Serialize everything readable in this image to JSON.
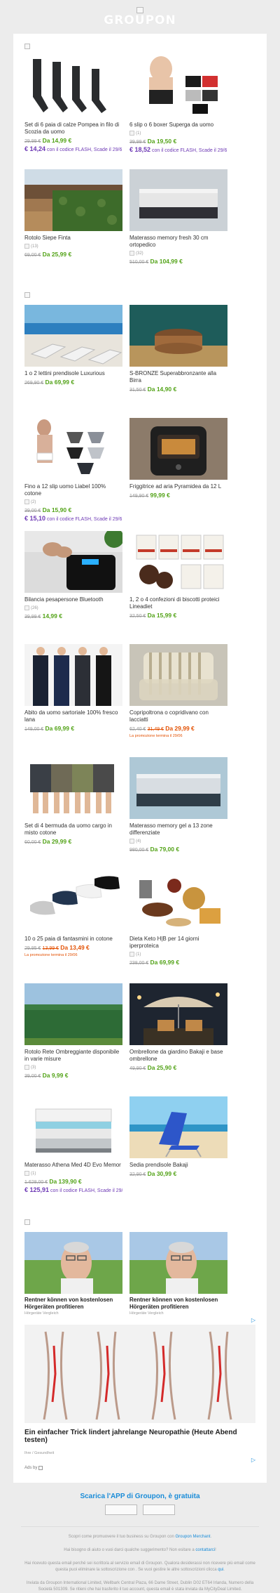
{
  "header": {
    "brand": "GROUPON"
  },
  "sections": [
    {
      "items": [
        {
          "title": "Set di 6 paia di calze Pompea in filo di Scozia da uomo",
          "old": "29,99 €",
          "new": "Da 14,99 €",
          "flash_price": "€ 14,24",
          "flash_text": "con il codice FLASH, Scade il 29/6",
          "image": "socks"
        },
        {
          "title": "6 slip o 6 boxer Superga da uomo",
          "stars": "(1)",
          "old": "39,99 €",
          "new": "Da 19,50 €",
          "flash_price": "€ 18,52",
          "flash_text": "con il codice FLASH, Scade il 29/6",
          "image": "boxers"
        },
        {
          "title": "Rotolo Siepe Finta",
          "stars": "(13)",
          "old": "69,00 €",
          "new": "Da 25,99 €",
          "image": "hedge"
        },
        {
          "title": "Materasso memory fresh 30 cm ortopedico",
          "stars": "(32)",
          "old": "510,00 €",
          "new": "Da 104,99 €",
          "image": "mattress"
        }
      ]
    },
    {
      "items": [
        {
          "title": "1 o 2 lettini prendisole Luxurious",
          "old": "269,90 €",
          "new": "Da 69,99 €",
          "image": "loungers"
        },
        {
          "title": "S-BRONZE Superabbronzante alla Birra",
          "old": "31,50 €",
          "new": "Da 14,90 €",
          "image": "cream"
        },
        {
          "title": "Fino a 12 slip uomo Liabel 100% cotone",
          "stars": "(2)",
          "old": "39,00 €",
          "new": "Da 15,90 €",
          "flash_price": "€ 15,10",
          "flash_text": "con il codice FLASH, Scade il 29/6",
          "image": "briefs"
        },
        {
          "title": "Friggitrice ad aria Pyramidea da 12 L",
          "old": "149,90 €",
          "new": "99,99 €",
          "image": "airfryer"
        },
        {
          "title": "Bilancia pesapersone Bluetooth",
          "stars": "(26)",
          "old": "39,99 €",
          "new": "14,99 €",
          "image": "scale"
        },
        {
          "title": "1, 2 o 4 confezioni di biscotti proteici Lineadiet",
          "old": "32,50 €",
          "new": "Da 15,99 €",
          "image": "biscuits"
        },
        {
          "title": "Abito da uomo sartoriale 100% fresco lana",
          "old": "149,00 €",
          "new": "Da 69,99 €",
          "image": "suits"
        },
        {
          "title": "Copripoltrona o copridivano con lacciatti",
          "old": "62,40 €",
          "old2": "31,49 €",
          "new": "Da 29,99 €",
          "red": true,
          "promo": "La promozione termina il 29/06",
          "image": "sofa"
        },
        {
          "title": "Set di 4 bermuda da uomo cargo in misto cotone",
          "old": "60,00 €",
          "new": "Da 29,99 €",
          "image": "shorts"
        },
        {
          "title": "Materasso memory gel a 13 zone differenziate",
          "stars": "(4)",
          "old": "980,00 €",
          "new": "Da 79,00 €",
          "image": "mattress2"
        },
        {
          "title": "10 o 25 paia di fantasmini in cotone",
          "old": "29,95 €",
          "old2": "13,99 €",
          "new": "Da 13,49 €",
          "red": true,
          "promo": "La promozione termina il 29/06",
          "image": "lowsocks"
        },
        {
          "title": "Dieta Keto H|B per 14 giorni iperproteica",
          "stars": "(1)",
          "old": "238,00 €",
          "new": "Da 69,99 €",
          "image": "keto"
        },
        {
          "title": "Rotolo Rete Ombreggiante disponibile in varie misure",
          "stars": "(3)",
          "old": "39,00 €",
          "new": "Da 9,99 €",
          "image": "shadenet"
        },
        {
          "title": "Ombrellone da giardino Bakaji e base ombrellone",
          "old": "49,90 €",
          "new": "Da 25,90 €",
          "image": "umbrella"
        },
        {
          "title": "Materasso Athena Med 4D Evo Memor",
          "stars": "(1)",
          "old": "1.628,00 €",
          "new": "Da 139,90 €",
          "flash_price": "€ 125,91",
          "flash_text": "con il codice FLASH, Scade il 29/6",
          "image": "mattress3"
        },
        {
          "title": "Sedia prendisole Bakaji",
          "old": "32,90 €",
          "new": "Da 30,99 €",
          "image": "beachchair"
        }
      ]
    }
  ],
  "ads": {
    "small": [
      {
        "title": "Rentner können von kostenlosen Hörgeräten profitieren",
        "source": "Hörgeräte Vergleich"
      },
      {
        "title": "Rentner können von kostenlosen Hörgeräten profitieren",
        "source": "Hörgeräte Vergleich"
      }
    ],
    "big": {
      "title": "Ein einfacher Trick lindert jahrelange Neuropathie (Heute Abend testen)",
      "source": "Ihre / Gesundheit"
    },
    "ads_by": "Ads by"
  },
  "app": {
    "title": "Scarica l'APP di Groupon, è gratuita"
  },
  "footer": {
    "line1_pre": "Scopri come promuovere il tuo business su Groupon con ",
    "line1_link": "Groupon Merchant",
    "line1_post": ".",
    "line2_pre": "Hai bisogno di aiuto o vuoi darci qualche suggerimento? Non esitare a ",
    "line2_link": "contattarci",
    "line2_post": "!",
    "line3_pre": "Hai ricevuto questa email perché sei iscritto/a al servizio email di Groupon. Qualora desiderassi non ricevere più email come questa puoi eliminare la sottoscrizione con . Se vuoi gestire le altre sottoscrizioni clicca ",
    "line3_link": "qui",
    "line3_post": ".",
    "line4": "Inviata da Groupon International Limited, Wellbark Central Plaza, 66 Dame Street, Dublin D02 ET64 Irlanda, Numero della Società 501309. Se ritieni che hai trasferito il tuo account, questa email è stata inviata da MyCityDeal Limited."
  }
}
